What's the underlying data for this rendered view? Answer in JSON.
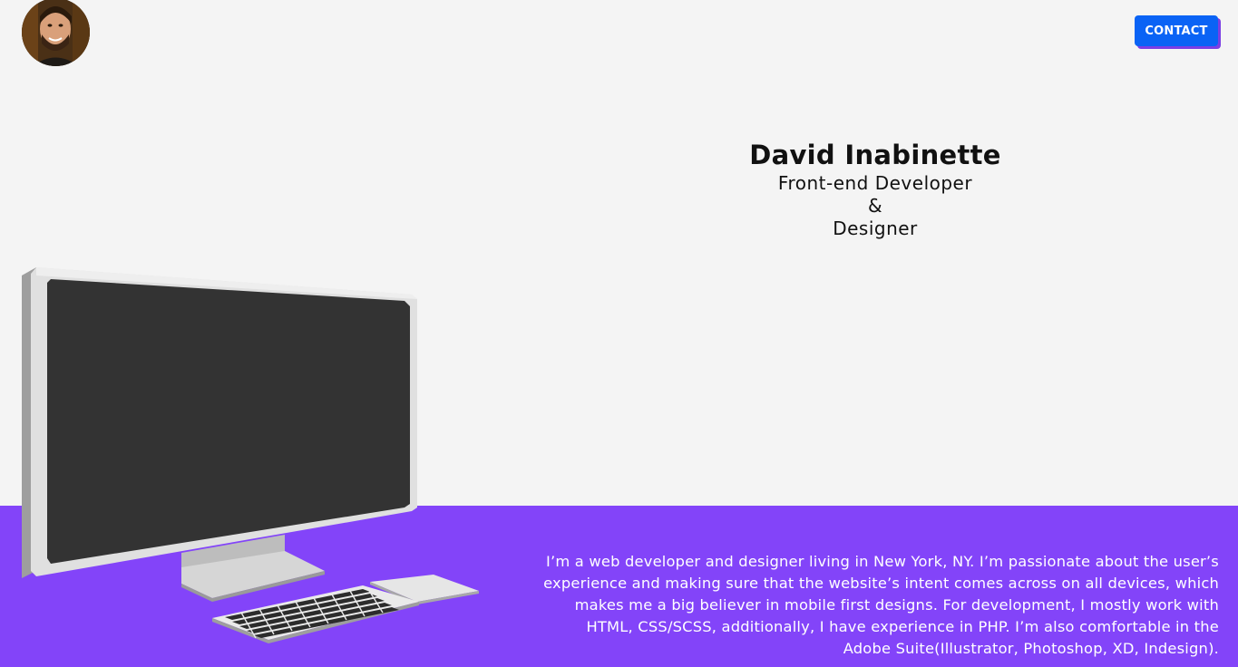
{
  "header": {
    "avatar_alt": "David Inabinette profile photo",
    "contact_label": "CONTACT"
  },
  "hero": {
    "name": "David Inabinette",
    "role_line1": "Front-end Developer",
    "role_line2": "&",
    "role_line3": "Designer"
  },
  "about": {
    "bio": "I’m a web developer and designer living in New York, NY. I’m passionate about the user’s experience and making sure that the website’s intent comes across on all devices, which makes me a big believer in mobile first designs. For development, I mostly work with HTML, CSS/SCSS, additionally, I have experience in PHP. I’m also comfortable in the Adobe Suite(Illustrator, Photoshop, XD, Indesign)."
  },
  "colors": {
    "background": "#f4f4f4",
    "accent_purple": "#8344f9",
    "button_blue": "#0a63f5"
  },
  "icons": {
    "illustration": "desktop-computer-illustration"
  }
}
